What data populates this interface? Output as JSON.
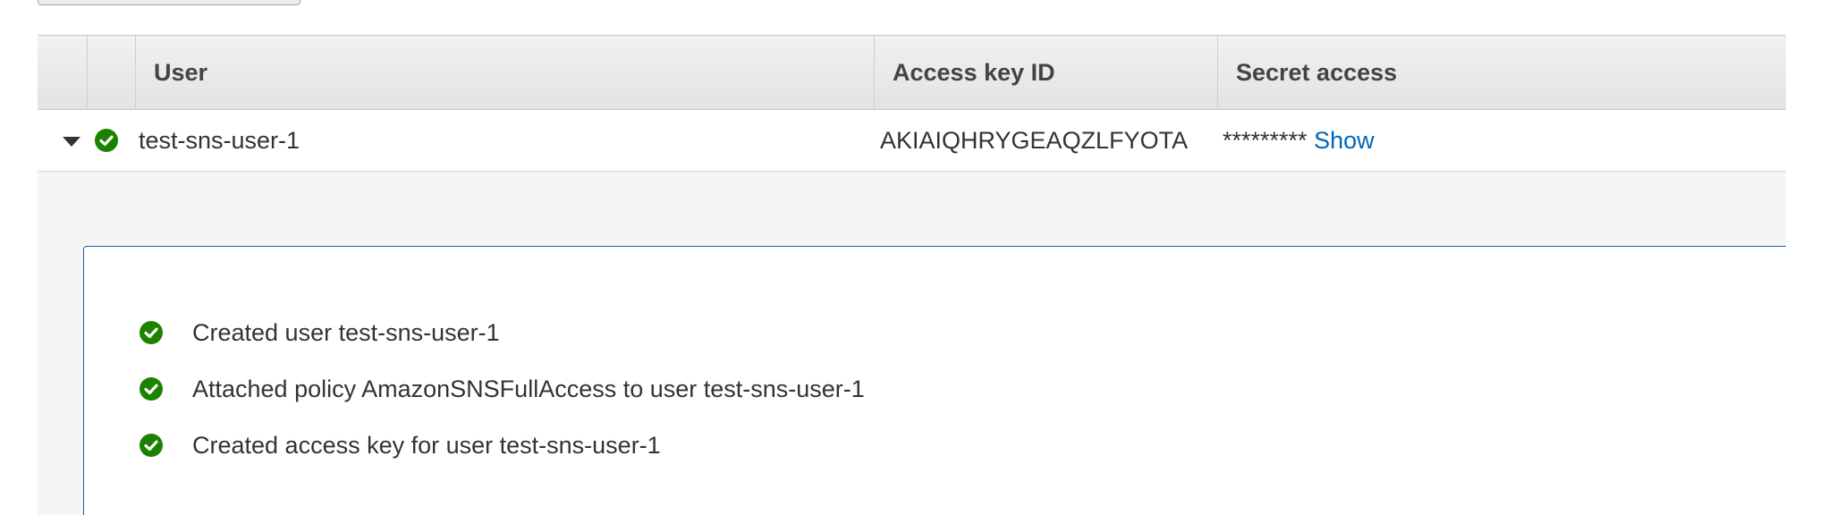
{
  "table": {
    "columns": {
      "user": "User",
      "access_key_id": "Access key ID",
      "secret_access": "Secret access"
    },
    "rows": [
      {
        "user": "test-sns-user-1",
        "access_key_id": "AKIAIQHRYGEAQZLFYOTA",
        "secret_masked": "*********",
        "show_label": "Show",
        "status": "success"
      }
    ]
  },
  "details": {
    "messages": [
      "Created user test-sns-user-1",
      "Attached policy AmazonSNSFullAccess to user test-sns-user-1",
      "Created access key for user test-sns-user-1"
    ]
  },
  "icons": {
    "status": "check-circle-icon",
    "expand": "caret-down-icon"
  },
  "colors": {
    "success_green": "#1d8102",
    "link_blue": "#0066b8",
    "detail_border": "#1f63a8"
  }
}
